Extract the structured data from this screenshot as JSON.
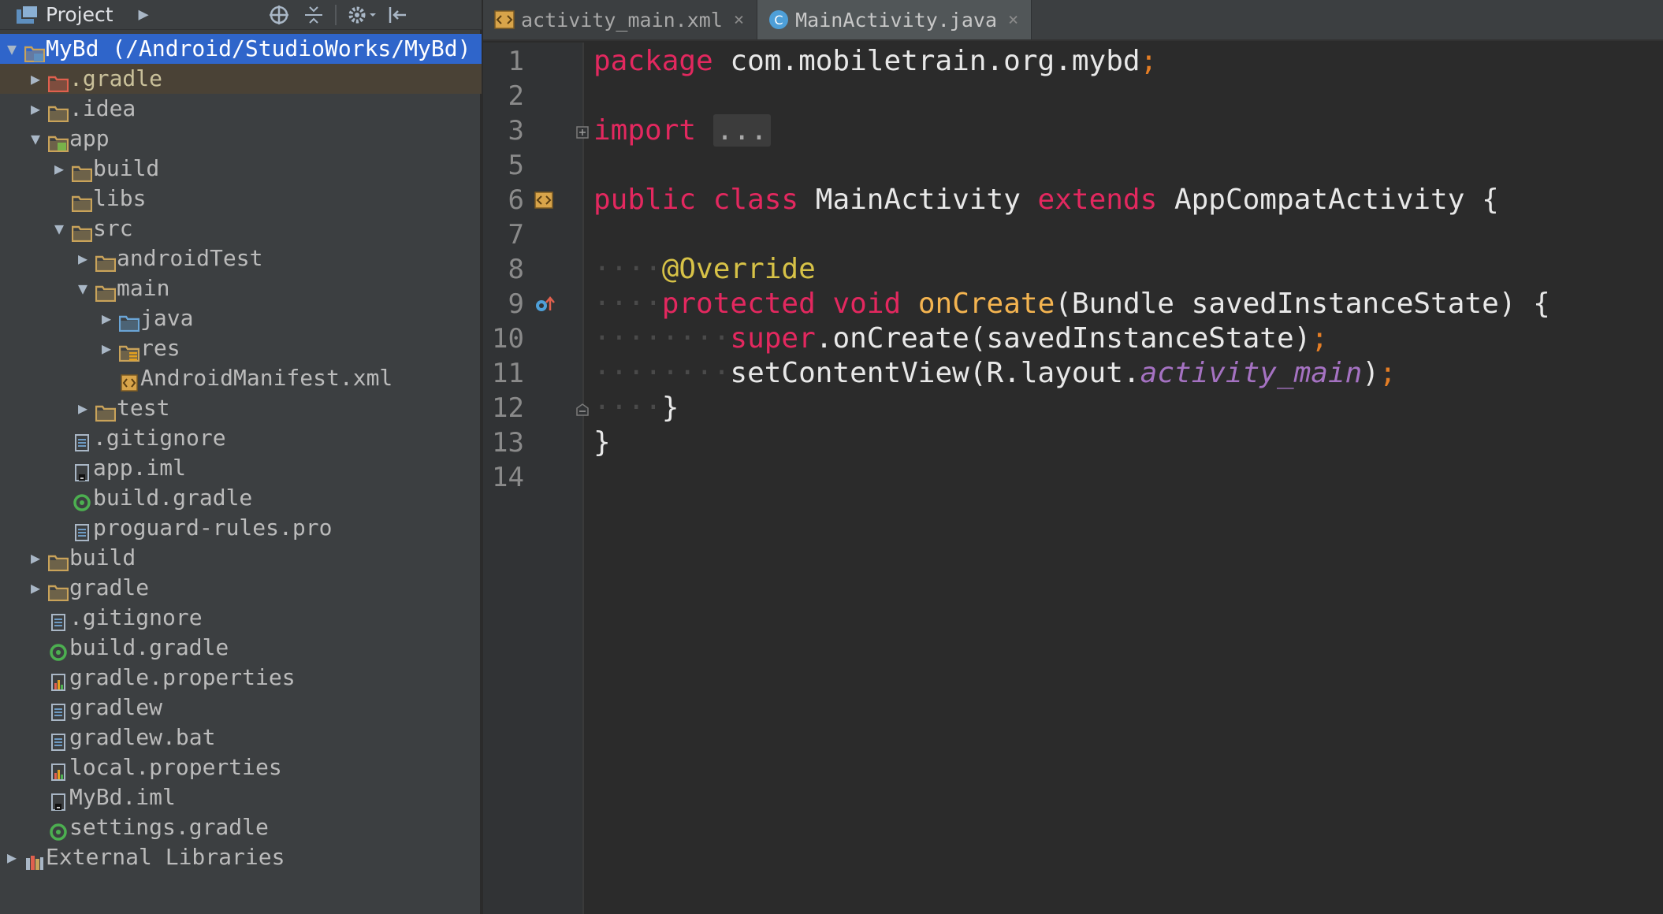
{
  "project": {
    "title": "Project",
    "tree": [
      {
        "label": "MyBd (/Android/StudioWorks/MyBd)",
        "level": 0,
        "arrow": "down",
        "icon": "project-module-icon",
        "state": "selected"
      },
      {
        "label": ".gradle",
        "level": 1,
        "arrow": "right",
        "icon": "folder-excluded-icon",
        "state": "ignored"
      },
      {
        "label": ".idea",
        "level": 1,
        "arrow": "right",
        "icon": "folder-icon"
      },
      {
        "label": "app",
        "level": 1,
        "arrow": "down",
        "icon": "module-folder-icon"
      },
      {
        "label": "build",
        "level": 2,
        "arrow": "right",
        "icon": "folder-icon"
      },
      {
        "label": "libs",
        "level": 2,
        "arrow": "",
        "icon": "folder-icon"
      },
      {
        "label": "src",
        "level": 2,
        "arrow": "down",
        "icon": "folder-icon"
      },
      {
        "label": "androidTest",
        "level": 3,
        "arrow": "right",
        "icon": "folder-icon"
      },
      {
        "label": "main",
        "level": 3,
        "arrow": "down",
        "icon": "folder-icon"
      },
      {
        "label": "java",
        "level": 4,
        "arrow": "right",
        "icon": "source-folder-icon"
      },
      {
        "label": "res",
        "level": 4,
        "arrow": "right",
        "icon": "resource-folder-icon"
      },
      {
        "label": "AndroidManifest.xml",
        "level": 4,
        "arrow": "",
        "icon": "xml-file-icon"
      },
      {
        "label": "test",
        "level": 3,
        "arrow": "right",
        "icon": "folder-icon"
      },
      {
        "label": ".gitignore",
        "level": 2,
        "arrow": "",
        "icon": "text-file-icon"
      },
      {
        "label": "app.iml",
        "level": 2,
        "arrow": "",
        "icon": "iml-file-icon"
      },
      {
        "label": "build.gradle",
        "level": 2,
        "arrow": "",
        "icon": "gradle-file-icon"
      },
      {
        "label": "proguard-rules.pro",
        "level": 2,
        "arrow": "",
        "icon": "text-file-icon"
      },
      {
        "label": "build",
        "level": 1,
        "arrow": "right",
        "icon": "folder-icon"
      },
      {
        "label": "gradle",
        "level": 1,
        "arrow": "right",
        "icon": "folder-icon"
      },
      {
        "label": ".gitignore",
        "level": 1,
        "arrow": "",
        "icon": "text-file-icon"
      },
      {
        "label": "build.gradle",
        "level": 1,
        "arrow": "",
        "icon": "gradle-file-icon"
      },
      {
        "label": "gradle.properties",
        "level": 1,
        "arrow": "",
        "icon": "properties-file-icon"
      },
      {
        "label": "gradlew",
        "level": 1,
        "arrow": "",
        "icon": "text-file-icon"
      },
      {
        "label": "gradlew.bat",
        "level": 1,
        "arrow": "",
        "icon": "text-file-icon"
      },
      {
        "label": "local.properties",
        "level": 1,
        "arrow": "",
        "icon": "properties-file-icon"
      },
      {
        "label": "MyBd.iml",
        "level": 1,
        "arrow": "",
        "icon": "iml-file-icon"
      },
      {
        "label": "settings.gradle",
        "level": 1,
        "arrow": "",
        "icon": "gradle-file-icon"
      },
      {
        "label": "External Libraries",
        "level": 0,
        "arrow": "right",
        "icon": "libraries-icon"
      }
    ]
  },
  "tabs": [
    {
      "label": "activity_main.xml",
      "icon": "xml-file-icon",
      "active": false
    },
    {
      "label": "MainActivity.java",
      "icon": "java-class-icon",
      "active": true
    }
  ],
  "editor": {
    "lines": [
      {
        "n": "1",
        "tokens": [
          [
            "kw",
            "package"
          ],
          [
            "pu",
            " com.mobiletrain.org.mybd"
          ],
          [
            "se",
            ";"
          ]
        ]
      },
      {
        "n": "2",
        "tokens": []
      },
      {
        "n": "3",
        "tokens": [
          [
            "kw",
            "import"
          ],
          [
            "pu",
            " "
          ],
          [
            "fold",
            "..."
          ]
        ],
        "gutter": "fold-expand-icon"
      },
      {
        "n": "5",
        "tokens": []
      },
      {
        "n": "6",
        "tokens": [
          [
            "kw",
            "public"
          ],
          [
            "pu",
            " "
          ],
          [
            "kw",
            "class"
          ],
          [
            "pu",
            " MainActivity "
          ],
          [
            "kw",
            "extends"
          ],
          [
            "pu",
            " AppCompatActivity {"
          ]
        ],
        "gutter": "layout-xml-icon"
      },
      {
        "n": "7",
        "tokens": []
      },
      {
        "n": "8",
        "tokens": [
          [
            "dots",
            "    "
          ],
          [
            "an",
            "@Override"
          ]
        ]
      },
      {
        "n": "9",
        "tokens": [
          [
            "dots",
            "    "
          ],
          [
            "kw",
            "protected"
          ],
          [
            "pu",
            " "
          ],
          [
            "kw",
            "void"
          ],
          [
            "pu",
            " "
          ],
          [
            "fn",
            "onCreate"
          ],
          [
            "pu",
            "(Bundle savedInstanceState) {"
          ]
        ],
        "gutter": "override-method-icon"
      },
      {
        "n": "10",
        "tokens": [
          [
            "dots",
            "        "
          ],
          [
            "kw",
            "super"
          ],
          [
            "pu",
            ".onCreate(savedInstanceState)"
          ],
          [
            "se",
            ";"
          ]
        ]
      },
      {
        "n": "11",
        "tokens": [
          [
            "dots",
            "        "
          ],
          [
            "pu",
            "setContentView(R.layout."
          ],
          [
            "it",
            "activity_main"
          ],
          [
            "pu",
            ")"
          ],
          [
            "se",
            ";"
          ]
        ]
      },
      {
        "n": "12",
        "tokens": [
          [
            "dots",
            "    "
          ],
          [
            "pu",
            "}"
          ]
        ],
        "gutter": "fold-collapse-icon"
      },
      {
        "n": "13",
        "tokens": [
          [
            "pu",
            "}"
          ]
        ]
      },
      {
        "n": "14",
        "tokens": []
      }
    ]
  },
  "colors": {
    "keyword": "#e3285f",
    "method": "#f4b450",
    "annotation": "#d7c247",
    "field": "#a572c2",
    "selection": "#2f65ca"
  }
}
